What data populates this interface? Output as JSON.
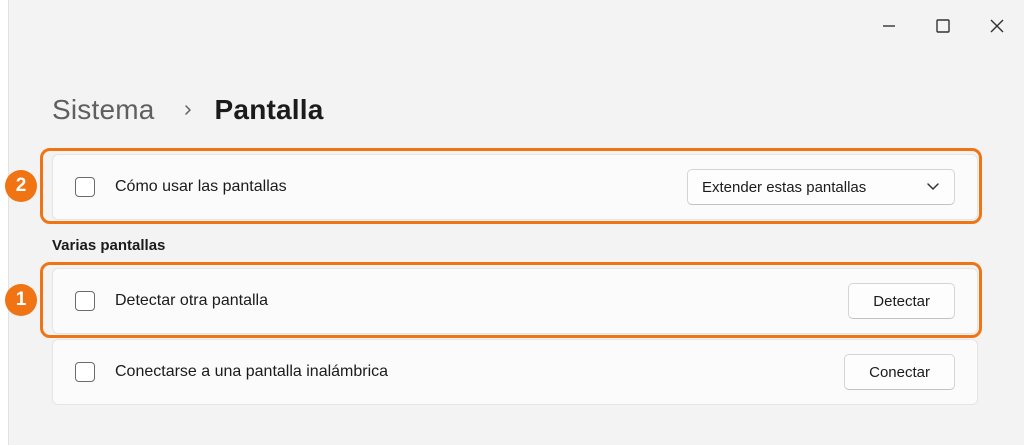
{
  "breadcrumb": {
    "parent": "Sistema",
    "current": "Pantalla"
  },
  "window_controls": {
    "minimize_icon": "minimize-icon",
    "maximize_icon": "maximize-icon",
    "close_icon": "close-icon"
  },
  "settings": {
    "how_to_use": {
      "label": "Cómo usar las pantallas",
      "dropdown_value": "Extender estas pantallas"
    },
    "section_title": "Varias pantallas",
    "detect": {
      "label": "Detectar otra pantalla",
      "button_label": "Detectar"
    },
    "wireless": {
      "label": "Conectarse a una pantalla inalámbrica",
      "button_label": "Conectar"
    }
  },
  "annotations": {
    "badge_1": "1",
    "badge_2": "2",
    "highlight_color": "#f07414"
  }
}
